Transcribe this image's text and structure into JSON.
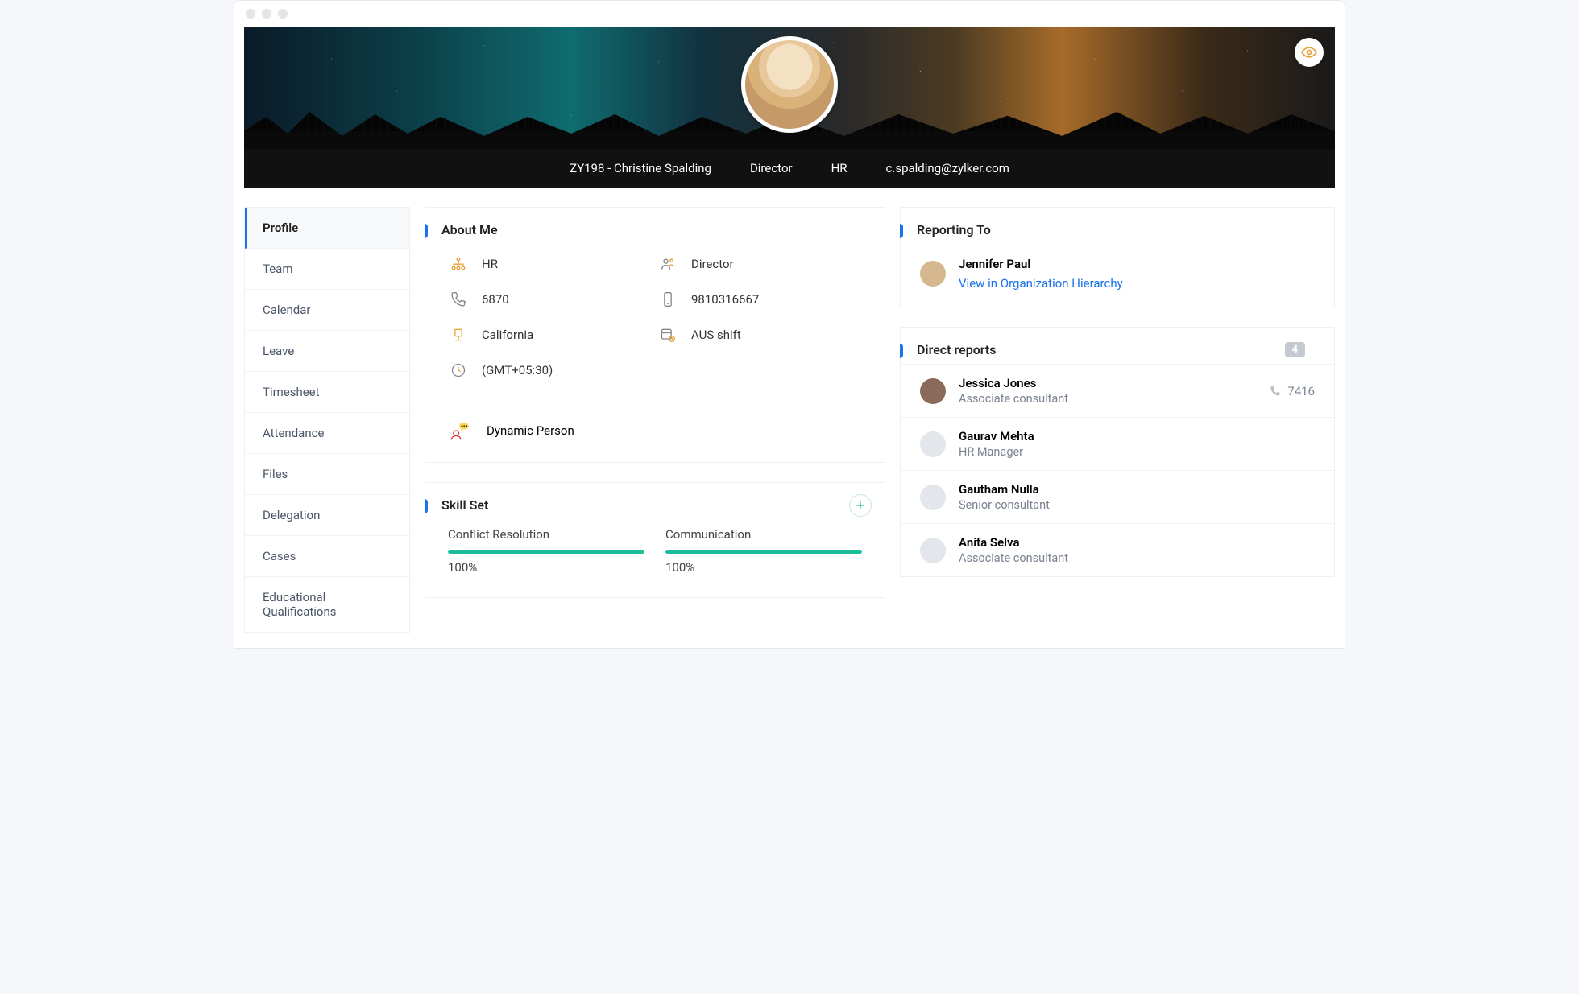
{
  "header": {
    "employee_id_name": "ZY198 - Christine Spalding",
    "job_title": "Director",
    "department": "HR",
    "email": "c.spalding@zylker.com"
  },
  "sidebar": {
    "items": [
      {
        "label": "Profile"
      },
      {
        "label": "Team"
      },
      {
        "label": "Calendar"
      },
      {
        "label": "Leave"
      },
      {
        "label": "Timesheet"
      },
      {
        "label": "Attendance"
      },
      {
        "label": "Files"
      },
      {
        "label": "Delegation"
      },
      {
        "label": "Cases"
      },
      {
        "label": "Educational Qualifications"
      }
    ]
  },
  "about": {
    "title": "About Me",
    "department": "HR",
    "designation": "Director",
    "extension": "6870",
    "mobile": "9810316667",
    "location": "California",
    "shift": "AUS shift",
    "timezone": "(GMT+05:30)",
    "tagline": "Dynamic Person"
  },
  "skills": {
    "title": "Skill Set",
    "items": [
      {
        "name": "Conflict Resolution",
        "percent": "100%",
        "value": 100
      },
      {
        "name": "Communication",
        "percent": "100%",
        "value": 100
      }
    ]
  },
  "reporting": {
    "title": "Reporting To",
    "manager_name": "Jennifer Paul",
    "hierarchy_link": "View in Organization Hierarchy"
  },
  "direct_reports": {
    "title": "Direct reports",
    "count": "4",
    "items": [
      {
        "name": "Jessica Jones",
        "title": "Associate consultant",
        "ext": "7416"
      },
      {
        "name": "Gaurav Mehta",
        "title": "HR Manager",
        "ext": ""
      },
      {
        "name": "Gautham Nulla",
        "title": "Senior consultant",
        "ext": ""
      },
      {
        "name": "Anita Selva",
        "title": "Associate consultant",
        "ext": ""
      }
    ]
  },
  "colors": {
    "accent_blue": "#1a73e8",
    "accent_green": "#1abc9c"
  }
}
